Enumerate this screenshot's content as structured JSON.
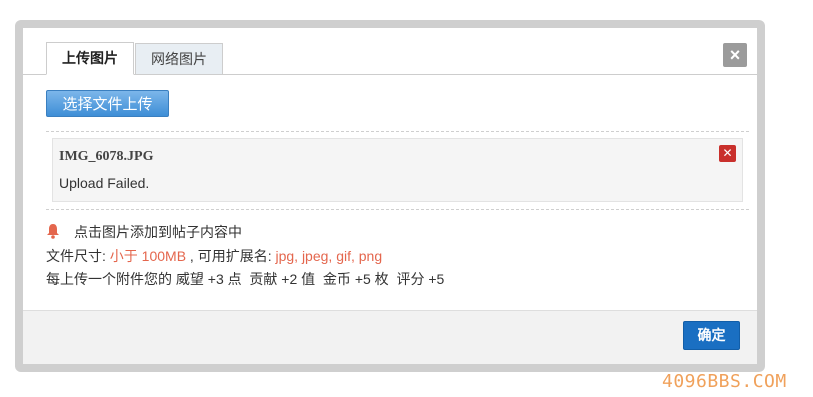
{
  "tabs": [
    {
      "label": "上传图片",
      "active": true
    },
    {
      "label": "网络图片",
      "active": false
    }
  ],
  "close_icon": "close-icon",
  "upload_button_label": "选择文件上传",
  "file": {
    "name": "IMG_6078.JPG",
    "status": "Upload Failed."
  },
  "remove_icon": "remove-icon",
  "info": {
    "hint": "点击图片添加到帖子内容中",
    "size_prefix": "文件尺寸: ",
    "size_value": "小于 100MB",
    "ext_prefix": " , 可用扩展名: ",
    "ext_value": "jpg, jpeg, gif, png",
    "reward": "每上传一个附件您的 威望 +3 点  贡献 +2 值  金币 +5 枚  评分 +5"
  },
  "confirm_label": "确定",
  "watermark": "4096BBS.COM",
  "colors": {
    "highlight": "#e4664d",
    "primary_button": "#1a6fc2",
    "upload_button": "#4a95d8",
    "error": "#c9302c",
    "bell": "#e4664d",
    "watermark": "#f0a15b"
  }
}
